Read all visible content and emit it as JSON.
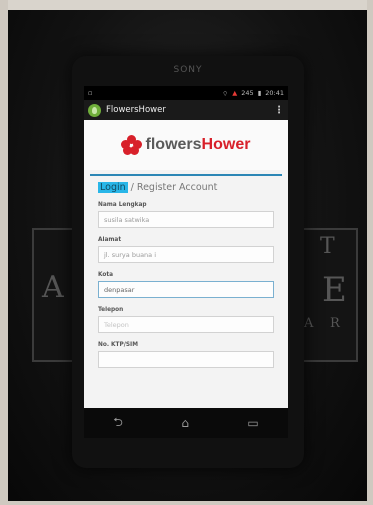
{
  "device": {
    "brand": "SONY"
  },
  "status_bar": {
    "left_icon": "notification-icon",
    "signal": "245",
    "time": "20:41"
  },
  "app_bar": {
    "title": "FlowersHower",
    "overflow": "⋮"
  },
  "logo": {
    "part1": "flowers",
    "part2": "Hower",
    "accent": "#d8202a"
  },
  "tabs": {
    "login": "Login",
    "separator": "/",
    "register": "Register Account"
  },
  "form": {
    "fields": [
      {
        "label": "Nama Lengkap",
        "value": "susila satwika"
      },
      {
        "label": "Alamat",
        "value": "jl. surya buana i"
      },
      {
        "label": "Kota",
        "value": "denpasar"
      },
      {
        "label": "Telepon",
        "placeholder": "Telepon"
      },
      {
        "label": "No. KTP/SIM",
        "placeholder": ""
      }
    ]
  },
  "nav": {
    "back": "⮌",
    "home": "⌂",
    "recent": "▭"
  },
  "poster": {
    "letters": [
      "E",
      "A",
      "R",
      "A",
      "T"
    ]
  }
}
